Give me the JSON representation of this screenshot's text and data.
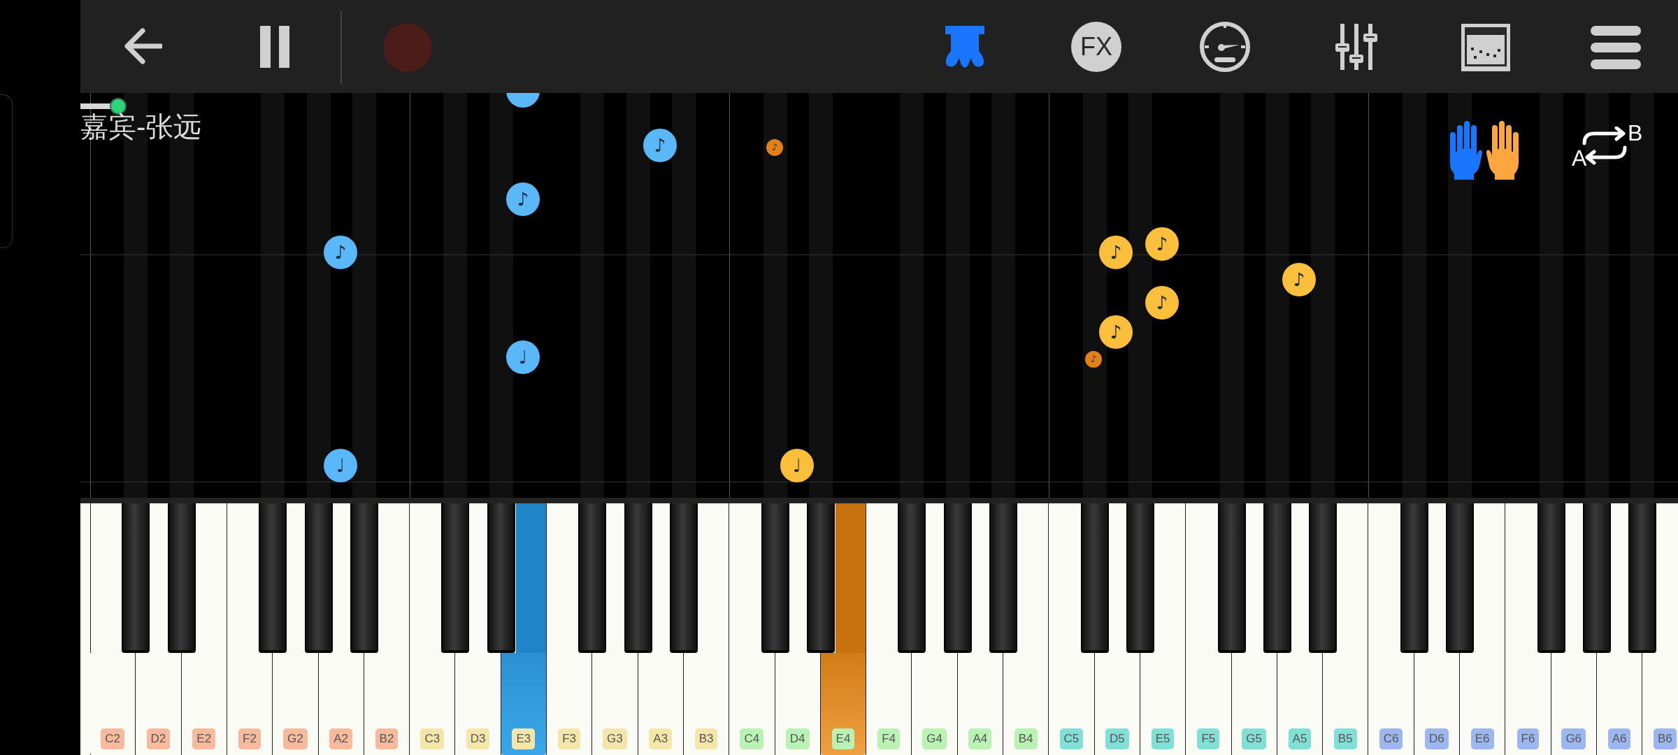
{
  "toolbar": {
    "fx_label": "FX"
  },
  "song": {
    "title": "嘉宾-张远",
    "level": 0.02
  },
  "loop": {
    "from": "A",
    "to": "B"
  },
  "notes": [
    {
      "right_hand": false,
      "small": false
    },
    {
      "right_hand": false,
      "small": false,
      "symbol": "♪"
    },
    {
      "right_hand": true,
      "small": true,
      "symbol": "♪"
    },
    {
      "right_hand": false,
      "small": false,
      "symbol": "♪"
    },
    {
      "right_hand": false,
      "small": false,
      "symbol": "♪"
    },
    {
      "right_hand": true,
      "small": false,
      "symbol": "♪"
    },
    {
      "right_hand": true,
      "small": false,
      "symbol": "♪"
    },
    {
      "right_hand": true,
      "small": false,
      "symbol": "♪"
    },
    {
      "right_hand": true,
      "small": false,
      "symbol": "♪"
    },
    {
      "right_hand": true,
      "small": false,
      "symbol": "♪"
    },
    {
      "right_hand": false,
      "small": false,
      "symbol": "♩"
    },
    {
      "right_hand": true,
      "small": true,
      "symbol": "♪"
    },
    {
      "right_hand": false,
      "small": false,
      "symbol": "♩"
    },
    {
      "right_hand": true,
      "small": false,
      "symbol": "♩"
    }
  ],
  "keys": [
    {
      "label": "C2",
      "color": "#f9b99d",
      "pressed_by_left_hand": false,
      "pressed_by_right_hand": false
    },
    {
      "label": "D2",
      "color": "#f9b99d",
      "pressed_by_left_hand": false,
      "pressed_by_right_hand": false
    },
    {
      "label": "E2",
      "color": "#f9b99d",
      "pressed_by_left_hand": false,
      "pressed_by_right_hand": false
    },
    {
      "label": "F2",
      "color": "#f9b99d",
      "pressed_by_left_hand": false,
      "pressed_by_right_hand": false
    },
    {
      "label": "G2",
      "color": "#f9b99d",
      "pressed_by_left_hand": false,
      "pressed_by_right_hand": false
    },
    {
      "label": "A2",
      "color": "#f9b99d",
      "pressed_by_left_hand": false,
      "pressed_by_right_hand": false
    },
    {
      "label": "B2",
      "color": "#f9b99d",
      "pressed_by_left_hand": false,
      "pressed_by_right_hand": false
    },
    {
      "label": "C3",
      "color": "#f3e6a8",
      "pressed_by_left_hand": false,
      "pressed_by_right_hand": false
    },
    {
      "label": "D3",
      "color": "#f3e6a8",
      "pressed_by_left_hand": false,
      "pressed_by_right_hand": false
    },
    {
      "label": "E3",
      "color": "#f3e6a8",
      "pressed_by_left_hand": true,
      "pressed_by_right_hand": false
    },
    {
      "label": "F3",
      "color": "#f3e6a8",
      "pressed_by_left_hand": false,
      "pressed_by_right_hand": false
    },
    {
      "label": "G3",
      "color": "#f3e6a8",
      "pressed_by_left_hand": false,
      "pressed_by_right_hand": false
    },
    {
      "label": "A3",
      "color": "#f3e6a8",
      "pressed_by_left_hand": false,
      "pressed_by_right_hand": false
    },
    {
      "label": "B3",
      "color": "#f3e6a8",
      "pressed_by_left_hand": false,
      "pressed_by_right_hand": false
    },
    {
      "label": "C4",
      "color": "#b9f2b3",
      "pressed_by_left_hand": false,
      "pressed_by_right_hand": false
    },
    {
      "label": "D4",
      "color": "#b9f2b3",
      "pressed_by_left_hand": false,
      "pressed_by_right_hand": false
    },
    {
      "label": "E4",
      "color": "#b9f2b3",
      "pressed_by_left_hand": false,
      "pressed_by_right_hand": true
    },
    {
      "label": "F4",
      "color": "#b9f2b3",
      "pressed_by_left_hand": false,
      "pressed_by_right_hand": false
    },
    {
      "label": "G4",
      "color": "#b9f2b3",
      "pressed_by_left_hand": false,
      "pressed_by_right_hand": false
    },
    {
      "label": "A4",
      "color": "#b9f2b3",
      "pressed_by_left_hand": false,
      "pressed_by_right_hand": false
    },
    {
      "label": "B4",
      "color": "#b9f2b3",
      "pressed_by_left_hand": false,
      "pressed_by_right_hand": false
    },
    {
      "label": "C5",
      "color": "#80e0d5",
      "pressed_by_left_hand": false,
      "pressed_by_right_hand": false
    },
    {
      "label": "D5",
      "color": "#80e0d5",
      "pressed_by_left_hand": false,
      "pressed_by_right_hand": false
    },
    {
      "label": "E5",
      "color": "#80e0d5",
      "pressed_by_left_hand": false,
      "pressed_by_right_hand": false
    },
    {
      "label": "F5",
      "color": "#80e0d5",
      "pressed_by_left_hand": false,
      "pressed_by_right_hand": false
    },
    {
      "label": "G5",
      "color": "#80e0d5",
      "pressed_by_left_hand": false,
      "pressed_by_right_hand": false
    },
    {
      "label": "A5",
      "color": "#80e0d5",
      "pressed_by_left_hand": false,
      "pressed_by_right_hand": false
    },
    {
      "label": "B5",
      "color": "#80e0d5",
      "pressed_by_left_hand": false,
      "pressed_by_right_hand": false
    },
    {
      "label": "C6",
      "color": "#9cb6ef",
      "pressed_by_left_hand": false,
      "pressed_by_right_hand": false
    },
    {
      "label": "D6",
      "color": "#9cb6ef",
      "pressed_by_left_hand": false,
      "pressed_by_right_hand": false
    },
    {
      "label": "E6",
      "color": "#9cb6ef",
      "pressed_by_left_hand": false,
      "pressed_by_right_hand": false
    },
    {
      "label": "F6",
      "color": "#9cb6ef",
      "pressed_by_left_hand": false,
      "pressed_by_right_hand": false
    },
    {
      "label": "G6",
      "color": "#9cb6ef",
      "pressed_by_left_hand": false,
      "pressed_by_right_hand": false
    },
    {
      "label": "A6",
      "color": "#9cb6ef",
      "pressed_by_left_hand": false,
      "pressed_by_right_hand": false
    },
    {
      "label": "B6",
      "color": "#9cb6ef",
      "pressed_by_left_hand": false,
      "pressed_by_right_hand": false
    }
  ]
}
